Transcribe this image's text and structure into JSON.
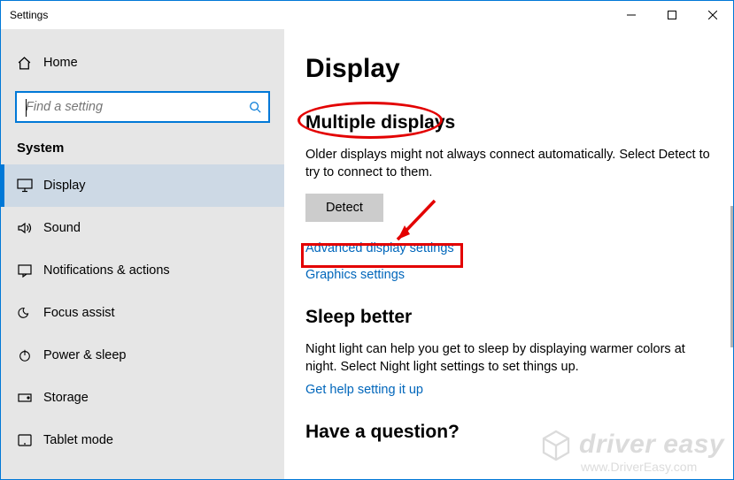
{
  "window": {
    "title": "Settings"
  },
  "sidebar": {
    "home_label": "Home",
    "search_placeholder": "Find a setting",
    "section_label": "System",
    "items": [
      {
        "label": "Display",
        "active": true
      },
      {
        "label": "Sound"
      },
      {
        "label": "Notifications & actions"
      },
      {
        "label": "Focus assist"
      },
      {
        "label": "Power & sleep"
      },
      {
        "label": "Storage"
      },
      {
        "label": "Tablet mode"
      }
    ]
  },
  "main": {
    "page_title": "Display",
    "multiple_displays": {
      "heading": "Multiple displays",
      "description": "Older displays might not always connect automatically. Select Detect to try to connect to them.",
      "detect_label": "Detect",
      "advanced_link": "Advanced display settings",
      "graphics_link": "Graphics settings"
    },
    "sleep_better": {
      "heading": "Sleep better",
      "description": "Night light can help you get to sleep by displaying warmer colors at night. Select Night light settings to set things up.",
      "link": "Get help setting it up"
    },
    "question_heading": "Have a question?"
  },
  "watermark": {
    "brand": "driver easy",
    "url": "www.DriverEasy.com"
  }
}
